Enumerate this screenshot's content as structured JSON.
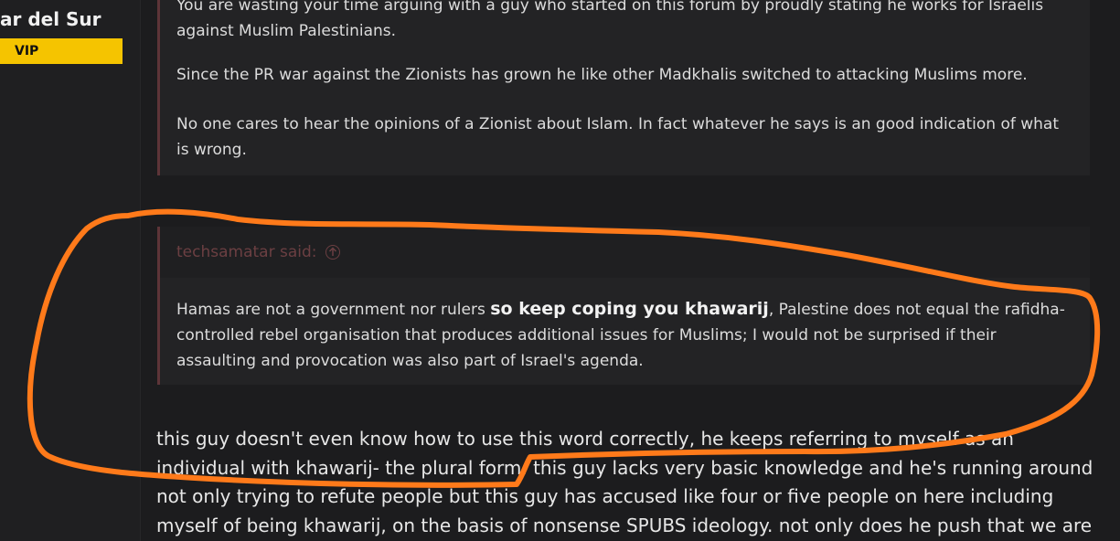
{
  "sidebar": {
    "user_name": "ar del Sur",
    "user_badge": "VIP"
  },
  "quote_top": {
    "paragraphs": [
      "You are wasting your time arguing with a guy who started on this forum by proudly stating he works for Israelis against Muslim Palestinians.",
      "Since the PR war against the Zionists has grown he like other Madkhalis switched to attacking Muslims more.",
      "No one cares to hear the opinions of a Zionist about Islam. In fact whatever he says is an good indication of what is wrong."
    ]
  },
  "quote_main": {
    "author": "techsamatar said:",
    "text_before": "Hamas are not a government nor rulers ",
    "text_emphasis": "so keep coping you khawarij",
    "text_after": ", Palestine does not equal the rafidha-controlled rebel organisation that produces additional issues for Muslims; I would not be surprised if their assaulting and provocation was also part of Israel's agenda."
  },
  "post": {
    "body": "this guy doesn't even know how to use this word correctly, he keeps referring to myself as an individual with khawarij- the plural form. this guy lacks very basic knowledge and he's running around not only trying to refute people but this guy has accused like four or five people on here including myself of being khawarij, on the basis of nonsense SPUBS ideology. not only does he push that we are"
  },
  "colors": {
    "annotation_stroke": "#ff7a1a",
    "badge": "#f5c400",
    "quote_accent": "#5d3438"
  },
  "icons": {
    "jump_to_quote": "arrow-up-circle-icon"
  }
}
